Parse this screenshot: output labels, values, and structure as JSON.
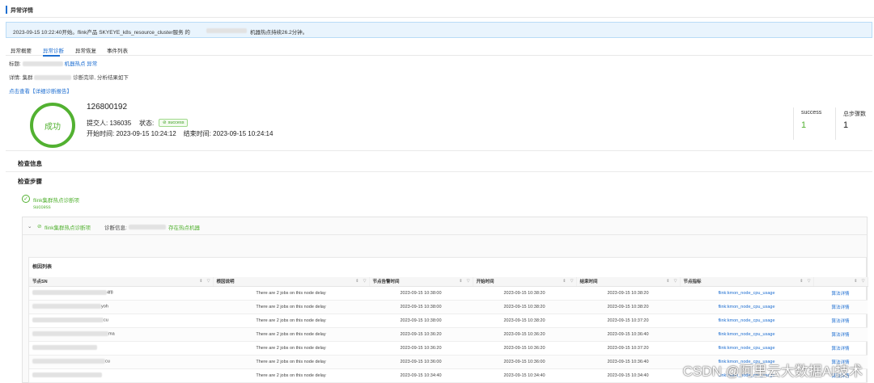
{
  "header": {
    "title": "异常详情"
  },
  "banner": {
    "text_before": "2023-09-15 10:22:40开始。flink产品 SKYEYE_k8s_resource_cluster服务 的",
    "text_after": "机器热点持续26.2分钟。"
  },
  "tabs": [
    {
      "label": "异常概要",
      "active": false
    },
    {
      "label": "异常诊断",
      "active": true
    },
    {
      "label": "异常恢复",
      "active": false
    },
    {
      "label": "事件列表",
      "active": false
    }
  ],
  "title_line": {
    "prefix": "标题:",
    "suffix": "机器热点 异常"
  },
  "detail_line": {
    "prefix": "详情: 集群",
    "suffix": "诊断完毕, 分析结果如下"
  },
  "report_link": "点击查看【详细诊断报告】",
  "job": {
    "status_circle": "成功",
    "id": "126800192",
    "submitter_label": "提交人:",
    "submitter": "136035",
    "status_label": "状态:",
    "status_tag": "success",
    "start_label": "开始时间:",
    "start_time": "2023-09-15 10:24:12",
    "end_label": "结束时间:",
    "end_time": "2023-09-15 10:24:14"
  },
  "stats": [
    {
      "label": "success",
      "value": "1",
      "color": "#52b131"
    },
    {
      "label": "总步骤数",
      "value": "1",
      "color": "#222222"
    }
  ],
  "sections": {
    "check_info": "检查信息",
    "check_steps": "检查步骤"
  },
  "step": {
    "name": "flink集群热点诊断项",
    "status": "success"
  },
  "panel": {
    "expand_icon": "chevron-down-icon",
    "name": "flink集群热点诊断项",
    "info_label": "诊断信息:",
    "info_suffix": "存在热点机器"
  },
  "root_cause": {
    "title": "根因列表",
    "columns": [
      "节点SN",
      "根因说明",
      "节点告警时间",
      "开始时间",
      "结束时间",
      "节点指标",
      ""
    ],
    "rows": [
      {
        "sn": "4f8",
        "desc": "There are 2 jobs on this node delay",
        "alarm": "2023-09-15 10:38:00",
        "start": "2023-09-15 10:38:20",
        "end": "2023-09-15 10:38:20",
        "metric": "flink:kmon_node_cpu_usage",
        "action": "算法详情"
      },
      {
        "sn": "yoh",
        "desc": "There are 2 jobs on this node delay",
        "alarm": "2023-09-15 10:38:00",
        "start": "2023-09-15 10:38:20",
        "end": "2023-09-15 10:38:20",
        "metric": "flink:kmon_node_cpu_usage",
        "action": "算法详情"
      },
      {
        "sn": "cu",
        "desc": "There are 2 jobs on this node delay",
        "alarm": "2023-09-15 10:38:00",
        "start": "2023-09-15 10:38:20",
        "end": "2023-09-15 10:37:20",
        "metric": "flink:kmon_node_cpu_usage",
        "action": "算法详情"
      },
      {
        "sn": "ma",
        "desc": "There are 2 jobs on this node delay",
        "alarm": "2023-09-15 10:36:20",
        "start": "2023-09-15 10:36:20",
        "end": "2023-09-15 10:36:40",
        "metric": "flink:kmon_node_cpu_usage",
        "action": "算法详情"
      },
      {
        "sn": "",
        "desc": "There are 2 jobs on this node delay",
        "alarm": "2023-09-15 10:36:20",
        "start": "2023-09-15 10:36:20",
        "end": "2023-09-15 10:37:20",
        "metric": "flink:kmon_node_cpu_usage",
        "action": "算法详情"
      },
      {
        "sn": "cu",
        "desc": "There are 2 jobs on this node delay",
        "alarm": "2023-09-15 10:36:00",
        "start": "2023-09-15 10:36:00",
        "end": "2023-09-15 10:36:40",
        "metric": "flink:kmon_node_cpu_usage",
        "action": "算法详情"
      },
      {
        "sn": "",
        "desc": "There are 2 jobs on this node delay",
        "alarm": "2023-09-15 10:34:40",
        "start": "2023-09-15 10:34:40",
        "end": "2023-09-15 10:34:40",
        "metric": "flink:kmon_node_cpu_usage",
        "action": "算法详情"
      }
    ]
  },
  "watermark": "CSDN @阿里云大数据AI技术"
}
